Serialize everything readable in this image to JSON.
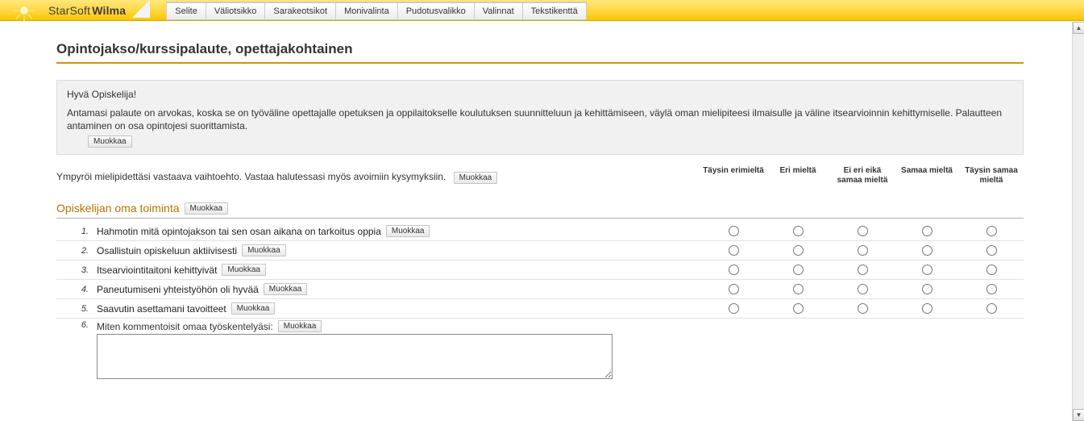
{
  "brand": {
    "company": "StarSoft",
    "product": "Wilma"
  },
  "menu": {
    "items": [
      "Selite",
      "Väliotsikko",
      "Sarakeotsikot",
      "Monivalinta",
      "Pudotusvalikko",
      "Valinnat",
      "Tekstikenttä"
    ]
  },
  "page": {
    "title": "Opintojakso/kurssipalaute, opettajakohtainen"
  },
  "intro": {
    "greeting": "Hyvä Opiskelija!",
    "body": "Antamasi palaute on arvokas, koska se on työväline opettajalle opetuksen ja oppilaitokselle koulutuksen suunnitteluun ja kehittämiseen, väylä oman mielipiteesi ilmaisulle ja väline itsearvioinnin kehittymiselle. Palautteen antaminen on osa opintojesi suorittamista."
  },
  "instructions": {
    "text": "Ympyröi mielipidettäsi vastaava vaihtoehto. Vastaa halutessasi myös avoimiin kysymyksiin."
  },
  "edit_label": "Muokkaa",
  "scale_headers": [
    "Täysin erimieltä",
    "Eri mieltä",
    "Ei eri eikä samaa mieltä",
    "Samaa mieltä",
    "Täysin samaa mieltä"
  ],
  "section": {
    "heading": "Opiskelijan oma toiminta",
    "questions": [
      {
        "n": "1.",
        "text": "Hahmotin mitä opintojakson tai sen osan aikana on tarkoitus oppia"
      },
      {
        "n": "2.",
        "text": "Osallistuin opiskeluun aktiivisesti"
      },
      {
        "n": "3.",
        "text": "Itsearviointitaitoni kehittyivät"
      },
      {
        "n": "4.",
        "text": "Paneutumiseni yhteistyöhön oli hyvää"
      },
      {
        "n": "5.",
        "text": "Saavutin asettamani tavoitteet"
      }
    ],
    "free": {
      "n": "6.",
      "label": "Miten kommentoisit omaa työskentelyäsi:"
    }
  }
}
